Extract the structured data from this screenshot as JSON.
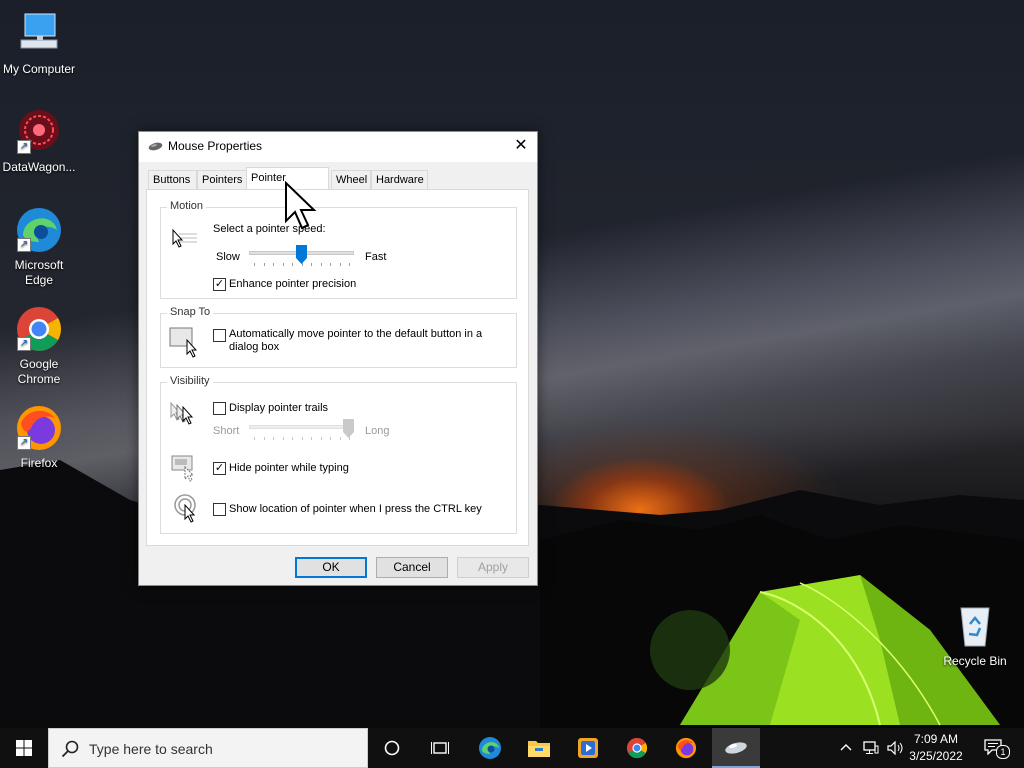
{
  "desktop": {
    "icons": [
      {
        "label": "My Computer",
        "icon": "computer-icon"
      },
      {
        "label": "DataWagon...",
        "icon": "datawagon-icon"
      },
      {
        "label": "Microsoft Edge",
        "icon": "edge-icon"
      },
      {
        "label": "Google Chrome",
        "icon": "chrome-icon"
      },
      {
        "label": "Firefox",
        "icon": "firefox-icon"
      },
      {
        "label": "Recycle Bin",
        "icon": "recycle-bin-icon"
      }
    ]
  },
  "dialog": {
    "title": "Mouse Properties",
    "close_glyph": "✕",
    "tabs": [
      {
        "label": "Buttons"
      },
      {
        "label": "Pointers"
      },
      {
        "label": "Pointer Options",
        "active": true
      },
      {
        "label": "Wheel"
      },
      {
        "label": "Hardware"
      }
    ],
    "motion": {
      "title": "Motion",
      "prompt": "Select a pointer speed:",
      "slow_label": "Slow",
      "fast_label": "Fast",
      "speed_fraction": 0.5,
      "precision_label": "Enhance pointer precision",
      "precision_checked": true
    },
    "snap_to": {
      "title": "Snap To",
      "label_line1": "Automatically move pointer to the default button in a",
      "label_line2": "dialog box",
      "checked": false
    },
    "visibility": {
      "title": "Visibility",
      "trails_label": "Display pointer trails",
      "trails_checked": false,
      "short_label": "Short",
      "long_label": "Long",
      "trail_length_fraction": 1.0,
      "hide_label": "Hide pointer while typing",
      "hide_checked": true,
      "location_label": "Show location of pointer when I press the CTRL key",
      "location_checked": false
    },
    "buttons": {
      "ok": "OK",
      "cancel": "Cancel",
      "apply": "Apply"
    },
    "check_glyph": "✓"
  },
  "taskbar": {
    "search_placeholder": "Type here to search",
    "time": "7:09 AM",
    "date": "3/25/2022",
    "notification_count": "1",
    "pinned": [
      "cortana-icon",
      "task-view-icon",
      "edge-icon",
      "file-explorer-icon",
      "media-player-icon",
      "chrome-icon",
      "firefox-icon",
      "mouse-properties-icon"
    ]
  }
}
